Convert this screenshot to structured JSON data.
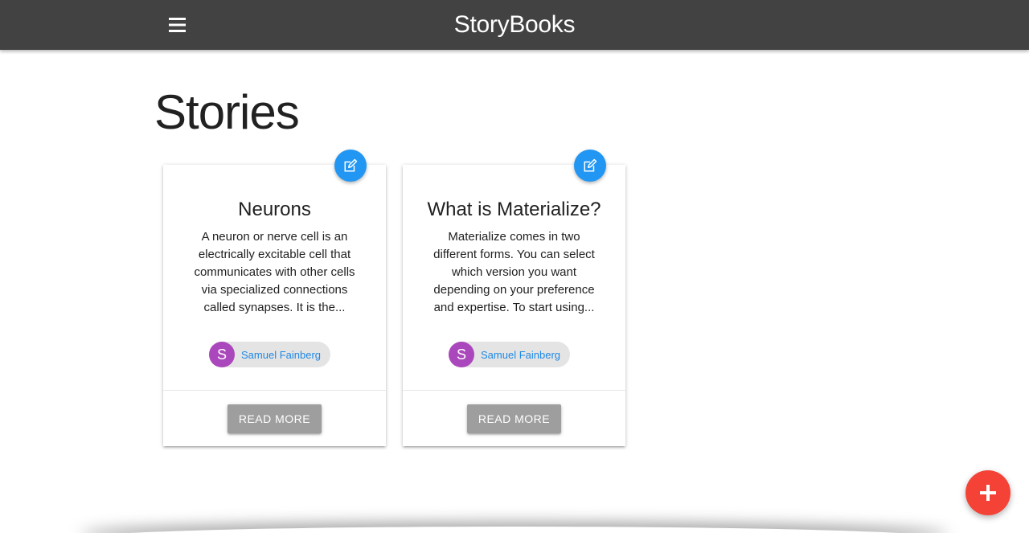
{
  "app": {
    "brand": "StoryBooks",
    "menu_icon": "hamburger-menu-icon"
  },
  "page": {
    "title": "Stories"
  },
  "stories": [
    {
      "title": "Neurons",
      "excerpt": "A neuron or nerve cell is an electrically excitable cell that communicates with other cells via specialized connections called synapses. It is the...",
      "author_initial": "S",
      "author_name": "Samuel Fainberg",
      "read_more_label": "READ MORE",
      "edit_icon": "edit-icon"
    },
    {
      "title": "What is Materialize?",
      "excerpt": "Materialize comes in two different forms. You can select which version you want depending on your preference and expertise. To start using...",
      "author_initial": "S",
      "author_name": "Samuel Fainberg",
      "read_more_label": "READ MORE",
      "edit_icon": "edit-icon"
    }
  ],
  "add_button": {
    "icon": "plus-icon"
  },
  "colors": {
    "navbar": "#424242",
    "edit_fab": "#2196f3",
    "add_fab": "#f44336",
    "avatar": "#ab47bc",
    "author_link": "#1e88e5",
    "read_more_button": "#9e9e9e"
  }
}
